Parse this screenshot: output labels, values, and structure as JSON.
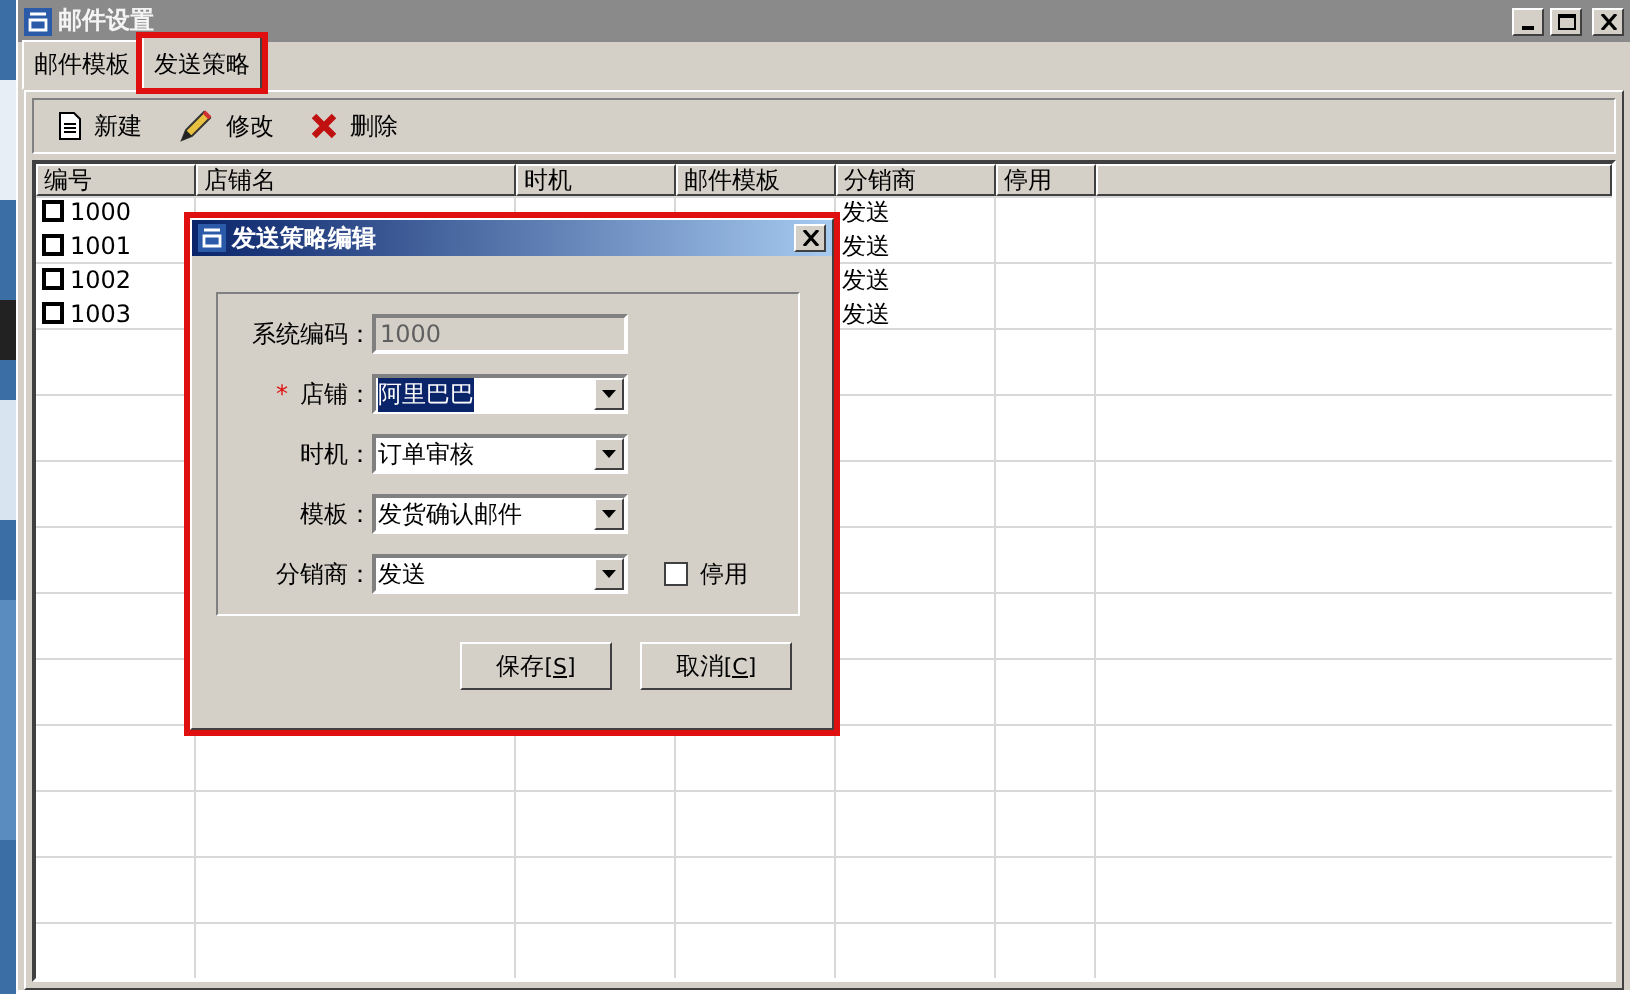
{
  "window": {
    "title": "邮件设置"
  },
  "tabs": [
    {
      "label": "邮件模板",
      "selected": false,
      "highlighted": false
    },
    {
      "label": "发送策略",
      "selected": true,
      "highlighted": true
    }
  ],
  "toolbar": [
    {
      "kind": "new",
      "label": "新建"
    },
    {
      "kind": "edit",
      "label": "修改"
    },
    {
      "kind": "delete",
      "label": "删除"
    }
  ],
  "table": {
    "columns": [
      "编号",
      "店铺名",
      "时机",
      "邮件模板",
      "分销商",
      "停用"
    ],
    "rows": [
      {
        "checked": false,
        "cells": [
          "1000",
          null,
          null,
          null,
          "发送"
        ]
      },
      {
        "checked": false,
        "cells": [
          "1001",
          null,
          null,
          null,
          "发送"
        ]
      },
      {
        "checked": false,
        "cells": [
          "1002",
          null,
          null,
          null,
          "发送"
        ]
      },
      {
        "checked": false,
        "cells": [
          "1003",
          null,
          null,
          null,
          "发送"
        ]
      }
    ]
  },
  "dialog": {
    "title": "发送策略编辑",
    "highlighted": true,
    "fields": [
      {
        "kind": "text",
        "label": "系统编码：",
        "value": "1000",
        "disabled": true
      },
      {
        "kind": "select",
        "label": "店铺：",
        "required_mark": "*",
        "value": "阿里巴巴",
        "text_selected": true
      },
      {
        "kind": "select",
        "label": "时机：",
        "value": "订单审核",
        "text_selected": false
      },
      {
        "kind": "select",
        "label": "模板：",
        "value": "发货确认邮件",
        "text_selected": false
      },
      {
        "kind": "select",
        "label": "分销商：",
        "value": "发送",
        "text_selected": false
      }
    ],
    "disable_checkbox": {
      "label": "停用",
      "checked": false
    },
    "buttons": [
      {
        "label": "保存",
        "hotkey": "[S]"
      },
      {
        "label": "取消",
        "hotkey": "[C]"
      }
    ]
  }
}
